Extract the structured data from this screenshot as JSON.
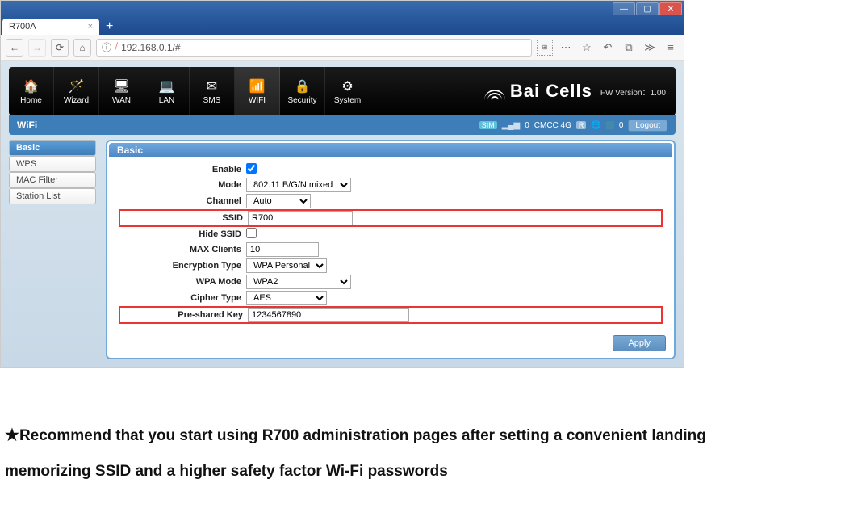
{
  "browser": {
    "tab_title": "R700A",
    "url": "192.168.0.1/#",
    "url_icon_info": "ⓘ",
    "toolbar_icons": [
      "back",
      "forward",
      "reload",
      "home"
    ]
  },
  "header": {
    "nav": [
      "Home",
      "Wizard",
      "WAN",
      "LAN",
      "SMS",
      "WIFI",
      "Security",
      "System"
    ],
    "active_nav": "WIFI",
    "brand": "Bai Cells",
    "fw_label": "FW Version：1.00"
  },
  "subheader": {
    "section_title": "WiFi",
    "status": {
      "sim_badge": "SIM",
      "sim_value": "0",
      "carrier": "CMCC 4G",
      "net_badge": "R",
      "globe_value": "0",
      "logout_label": "Logout"
    }
  },
  "sidebar": {
    "items": [
      "Basic",
      "WPS",
      "MAC Filter",
      "Station List"
    ],
    "active": "Basic"
  },
  "panel": {
    "title": "Basic",
    "fields": {
      "enable_label": "Enable",
      "enable_checked": true,
      "mode_label": "Mode",
      "mode_value": "802.11 B/G/N mixed",
      "channel_label": "Channel",
      "channel_value": "Auto",
      "ssid_label": "SSID",
      "ssid_value": "R700",
      "hide_ssid_label": "Hide SSID",
      "hide_ssid_checked": false,
      "max_clients_label": "MAX Clients",
      "max_clients_value": "10",
      "enc_type_label": "Encryption Type",
      "enc_type_value": "WPA Personal",
      "wpa_mode_label": "WPA Mode",
      "wpa_mode_value": "WPA2",
      "cipher_label": "Cipher Type",
      "cipher_value": "AES",
      "psk_label": "Pre-shared Key",
      "psk_value": "1234567890"
    },
    "apply_label": "Apply"
  },
  "footnote": {
    "star": "★",
    "line1": "Recommend that you start using R700 administration pages after setting a convenient landing",
    "line2": "memorizing SSID and a higher safety factor Wi-Fi passwords"
  }
}
